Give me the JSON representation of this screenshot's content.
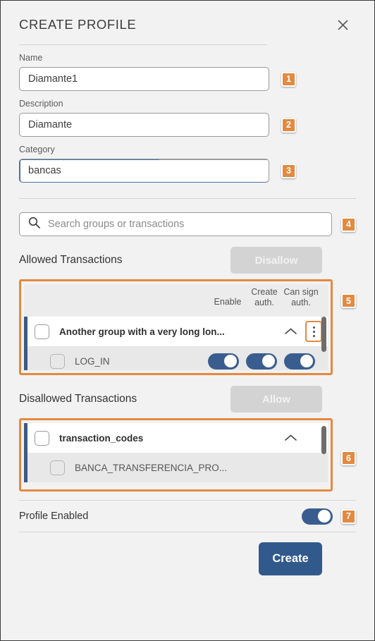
{
  "dialog": {
    "title": "CREATE PROFILE",
    "close_icon": "close-icon"
  },
  "form": {
    "name": {
      "label": "Name",
      "value": "Diamante1",
      "placeholder": "",
      "badge": "1"
    },
    "description": {
      "label": "Description",
      "value": "Diamante",
      "placeholder": "",
      "badge": "2"
    },
    "category": {
      "label": "Category",
      "value": "bancas",
      "placeholder": "",
      "badge": "3"
    }
  },
  "search": {
    "placeholder": "Search groups or transactions",
    "value": "",
    "icon": "search-icon",
    "badge": "4"
  },
  "allowed": {
    "title": "Allowed Transactions",
    "action_label": "Disallow",
    "action_disabled": true,
    "badge": "5",
    "columns": [
      "Enable",
      "Create auth.",
      "Can sign auth."
    ],
    "groups": [
      {
        "name": "Another group with a very long lon...",
        "checked": false,
        "expanded": true,
        "has_kebab": true,
        "kebab_highlighted": true,
        "children": [
          {
            "name": "LOG_IN",
            "checked": false,
            "enable": true,
            "create_auth": true,
            "can_sign_auth": true
          }
        ]
      }
    ]
  },
  "disallowed": {
    "title": "Disallowed Transactions",
    "action_label": "Allow",
    "action_disabled": true,
    "badge": "6",
    "groups": [
      {
        "name": "transaction_codes",
        "checked": false,
        "expanded": true,
        "has_kebab": false,
        "children": [
          {
            "name": "BANCA_TRANSFERENCIA_PRO...",
            "checked": false
          }
        ]
      }
    ]
  },
  "footer": {
    "profile_enabled_label": "Profile Enabled",
    "profile_enabled": true,
    "profile_badge": "7",
    "create_label": "Create"
  },
  "colors": {
    "accent_orange": "#e4893f",
    "primary_blue": "#31598c",
    "toggle_blue": "#3a5d8f",
    "row_accent_blue": "#3d5a86",
    "background": "#f2f2f2",
    "disabled_gray": "#d3d3d3"
  }
}
